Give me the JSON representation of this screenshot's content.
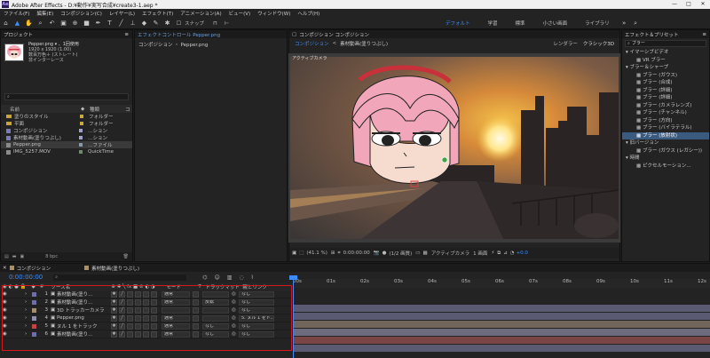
{
  "window": {
    "app_logo": "Ae",
    "title": "Adobe After Effects - D:¥動作¥実写合成¥create3-1.aep *",
    "buttons": [
      "—",
      "□",
      "✕"
    ]
  },
  "menu": [
    "ファイル(F)",
    "編集(E)",
    "コンポジション(C)",
    "レイヤー(L)",
    "エフェクト(T)",
    "アニメーション(A)",
    "ビュー(V)",
    "ウィンドウ(W)",
    "ヘルプ(H)"
  ],
  "toolbar": {
    "snap_label": "スナップ",
    "workspaces": [
      "デフォルト",
      "学習",
      "標準",
      "小さい画面",
      "ライブラリ"
    ],
    "active_workspace": "デフォルト"
  },
  "project": {
    "tab": "プロジェクト",
    "item_name": "Pepper.png ▾ 、1回使用",
    "item_meta": [
      "1920 x 1920 (1.00)",
      "数百万色＋ (ストレート)",
      "非インターレース"
    ],
    "search_placeholder": "⌕",
    "columns": {
      "name": "名前",
      "type": "種類",
      "col3": "コ"
    },
    "items": [
      {
        "name": "塗りのスタイル",
        "type": "フォルダー",
        "kind": "folder",
        "label_color": "#c9a93a"
      },
      {
        "name": "平面",
        "type": "フォルダー",
        "kind": "folder",
        "label_color": "#c9a93a"
      },
      {
        "name": "コンポジション",
        "type": "…ション",
        "kind": "comp",
        "label_color": "#a0a0cc"
      },
      {
        "name": "素材動画(塗りつぶし)",
        "type": "…ション",
        "kind": "comp",
        "label_color": "#a0a0cc"
      },
      {
        "name": "Pepper.png",
        "type": "…ファイル",
        "kind": "file",
        "label_color": "#8899aa",
        "selected": true
      },
      {
        "name": "IMG_5257.MOV",
        "type": "QuickTime",
        "kind": "file",
        "label_color": "#6c8c6c"
      }
    ],
    "footer_bpc": "8 bpc"
  },
  "effect_controls": {
    "tab": "エフェクトコントロール Pepper.png",
    "breadcrumb": "コンポジション ・ Pepper.png"
  },
  "composition": {
    "tab": "コンポジション コンポジション",
    "subtabs": [
      "コンポジション",
      "素材動画(塗りつぶし)"
    ],
    "renderer_label": "レンダラー",
    "renderer_value": "クラシック3D",
    "viewer_label": "アクティブカメラ",
    "bottom": {
      "zoom": "(41.1 %)",
      "timecode": "0:00:00:00",
      "resolution": "(1/2 画質)",
      "camera": "アクティブカメラ",
      "views": "1 画面",
      "exposure": "+0.0"
    }
  },
  "effects_presets": {
    "tab": "エフェクト＆プリセット",
    "search_value": "ブラー",
    "items": [
      {
        "text": "▾ イマーシブビデオ",
        "level": "cat"
      },
      {
        "text": "VR ブラー",
        "level": "sub"
      },
      {
        "text": "▾ ブラー＆シャープ",
        "level": "cat"
      },
      {
        "text": "ブラー (ガウス)",
        "level": "sub"
      },
      {
        "text": "ブラー (合成)",
        "level": "sub"
      },
      {
        "text": "ブラー (詳細)",
        "level": "sub"
      },
      {
        "text": "ブラー (詳細)",
        "level": "sub"
      },
      {
        "text": "ブラー (カメラレンズ)",
        "level": "sub"
      },
      {
        "text": "ブラー (チャンネル)",
        "level": "sub"
      },
      {
        "text": "ブラー (方向)",
        "level": "sub"
      },
      {
        "text": "ブラー (バイラテラル)",
        "level": "sub"
      },
      {
        "text": "ブラー (放射状)",
        "level": "sub",
        "selected": true
      },
      {
        "text": "▾ 旧バージョン",
        "level": "cat"
      },
      {
        "text": "ブラー (ガウス (レガシー))",
        "level": "sub"
      },
      {
        "text": "▾ 時間",
        "level": "cat"
      },
      {
        "text": "ピクセルモーション...",
        "level": "sub"
      }
    ]
  },
  "timeline": {
    "tabs": [
      "コンポジション",
      "素材動画(塗りつぶし)"
    ],
    "timecode": "0:00:00:00",
    "search_placeholder": "⌕",
    "ruler": [
      "00s",
      "01s",
      "02s",
      "03s",
      "04s",
      "05s",
      "06s",
      "07s",
      "08s",
      "09s",
      "10s",
      "11s",
      "12s"
    ],
    "headers": {
      "source": "ソース名",
      "mode": "モード",
      "t": "T",
      "trackmatte": "トラックマット",
      "parent": "親とリンク"
    },
    "layers": [
      {
        "num": "1",
        "name": "素材動画(塗り...",
        "color": "#6f6fa6",
        "mode": "通常",
        "matte": "",
        "parent": "なし",
        "track_color": "#5b5a73"
      },
      {
        "num": "2",
        "name": "素材動画(塗り...",
        "color": "#6f6fa6",
        "mode": "通常",
        "matte": "反転",
        "parent": "なし",
        "track_color": "#5b5a73"
      },
      {
        "num": "3",
        "name": "3D トラッカーカメラ",
        "color": "#a58f73",
        "mode": "",
        "matte": "",
        "parent": "なし",
        "track_color": "#72655a"
      },
      {
        "num": "4",
        "name": "Pepper.png",
        "color": "#8f8faa",
        "mode": "通常",
        "matte": "",
        "parent": "5. ヌル 1 をト...",
        "track_color": "#6d6c7e"
      },
      {
        "num": "5",
        "name": "ヌル 1 をトラック",
        "color": "#c24444",
        "mode": "通常",
        "matte": "なし",
        "parent": "なし",
        "track_color": "#7a4545"
      },
      {
        "num": "6",
        "name": "素材動画(塗り...",
        "color": "#6f6fa6",
        "mode": "通常",
        "matte": "なし",
        "parent": "なし",
        "track_color": "#5b5a73"
      }
    ],
    "switch_labels": "⊕ ✱ ╲ fx ■ ⊘ ◐ ◑"
  },
  "colors": {
    "accent": "#3c8cff",
    "highlight_border": "#d21818"
  }
}
